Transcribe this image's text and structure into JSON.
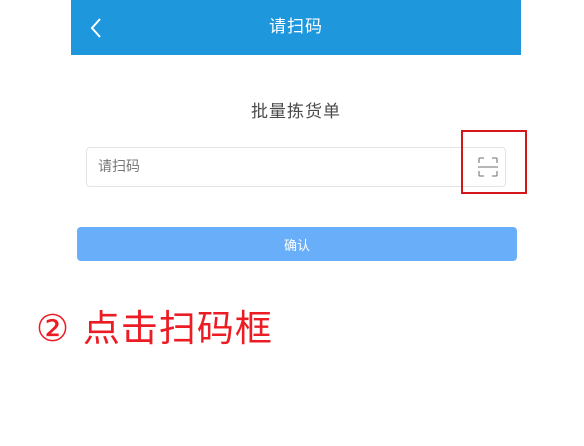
{
  "header": {
    "title": "请扫码",
    "back_icon": "chevron-left-icon",
    "background": "#1e97dc"
  },
  "subtitle": "批量拣货单",
  "scan_input": {
    "placeholder": "请扫码",
    "value": "",
    "icon": "scan-frame-icon"
  },
  "confirm_label": "确认",
  "annotation": {
    "text": "② 点击扫码框",
    "color": "#ec1c24",
    "highlight_color": "#d5161b"
  }
}
